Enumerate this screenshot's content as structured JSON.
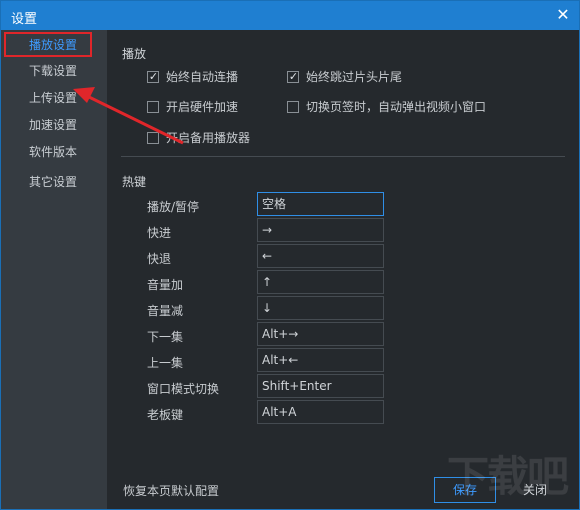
{
  "window": {
    "title": "设置",
    "close_icon": "close-icon"
  },
  "sidebar": {
    "items": [
      {
        "label": "播放设置",
        "active": true
      },
      {
        "label": "下载设置",
        "active": false
      },
      {
        "label": "上传设置",
        "active": false
      },
      {
        "label": "加速设置",
        "active": false
      },
      {
        "label": "软件版本",
        "active": false
      },
      {
        "label": "其它设置",
        "active": false
      }
    ]
  },
  "playback": {
    "title": "播放",
    "options": [
      {
        "label": "始终自动连播",
        "checked": true
      },
      {
        "label": "始终跳过片头片尾",
        "checked": true
      },
      {
        "label": "开启硬件加速",
        "checked": false
      },
      {
        "label": "切换页签时，自动弹出视频小窗口",
        "checked": false
      },
      {
        "label": "开启备用播放器",
        "checked": false
      }
    ]
  },
  "hotkeys": {
    "title": "热键",
    "items": [
      {
        "label": "播放/暂停",
        "value": "空格"
      },
      {
        "label": "快进",
        "value": "→"
      },
      {
        "label": "快退",
        "value": "←"
      },
      {
        "label": "音量加",
        "value": "↑"
      },
      {
        "label": "音量减",
        "value": "↓"
      },
      {
        "label": "下一集",
        "value": "Alt+→"
      },
      {
        "label": "上一集",
        "value": "Alt+←"
      },
      {
        "label": "窗口模式切换",
        "value": "Shift+Enter"
      },
      {
        "label": "老板键",
        "value": "Alt+A"
      }
    ]
  },
  "footer": {
    "restore_label": "恢复本页默认配置",
    "save_label": "保存",
    "close_label": "关闭"
  },
  "watermark": {
    "text": "下载吧"
  },
  "colors": {
    "titlebar": "#1f7fd1",
    "accent": "#3d9bff",
    "annotation": "#e0262a",
    "sidebar": "#353b41",
    "panel": "#25292d"
  }
}
